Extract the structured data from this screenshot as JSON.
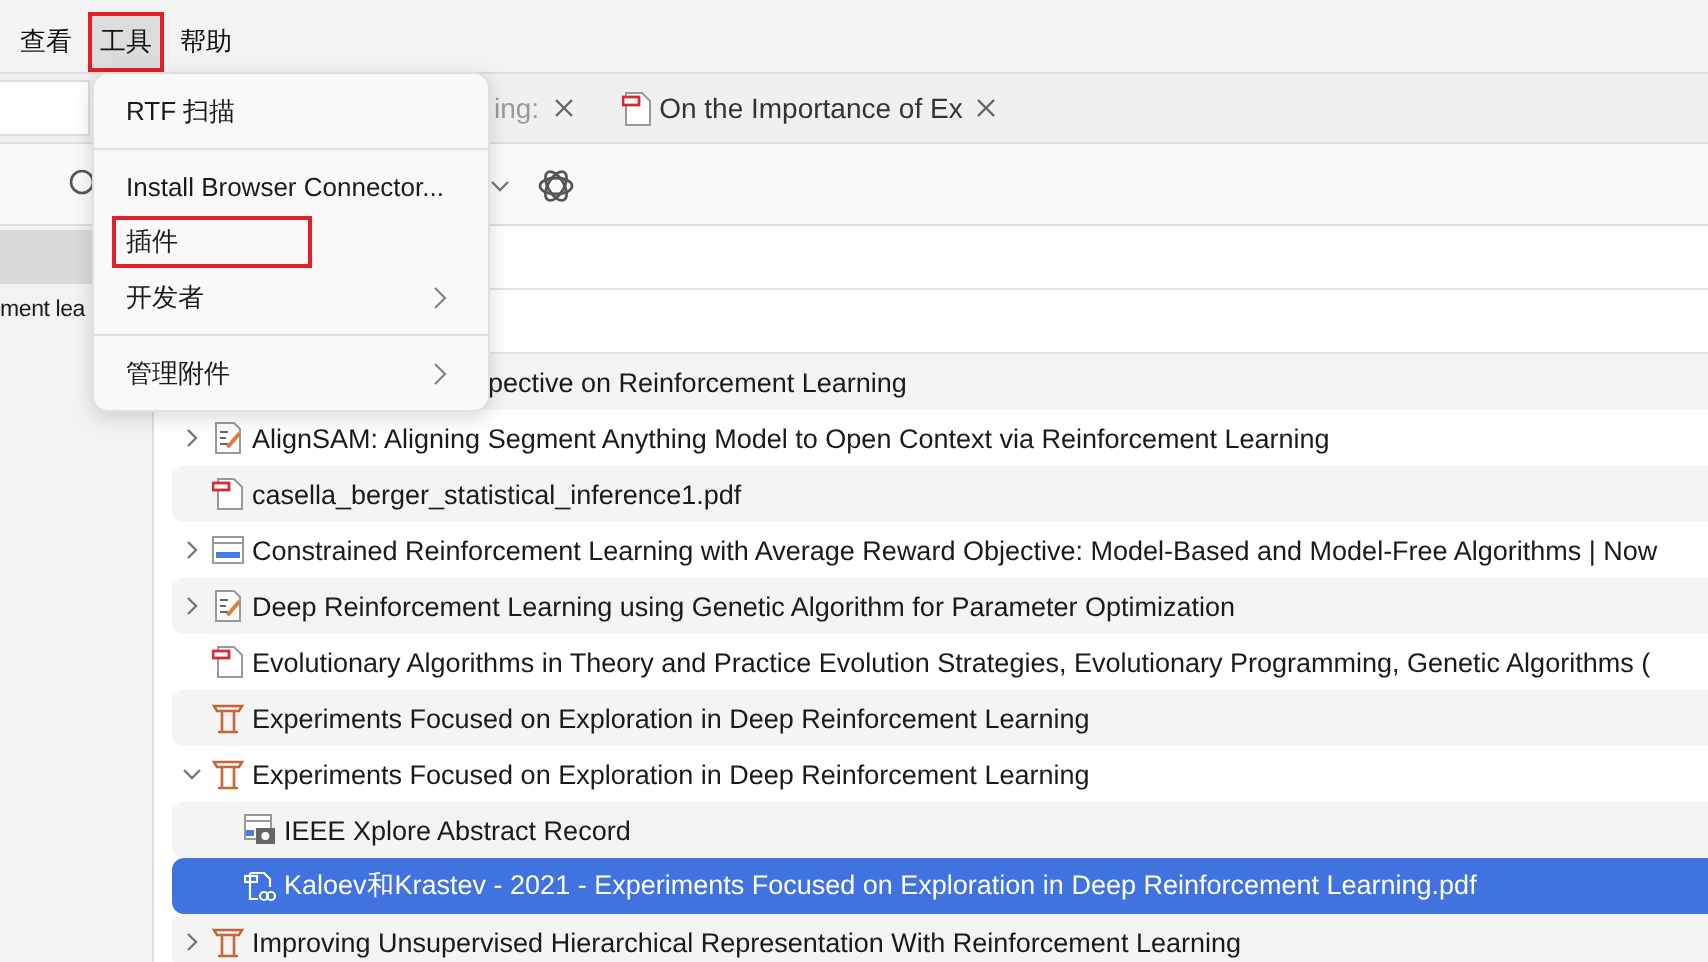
{
  "menu_bar": [
    {
      "label": "查看",
      "selected": false,
      "highlighted": false
    },
    {
      "label": "工具",
      "selected": true,
      "highlighted": true
    },
    {
      "label": "帮助",
      "selected": false,
      "highlighted": false
    }
  ],
  "tabs": [
    {
      "label": "ing:",
      "selected": false,
      "kind": "plain"
    },
    {
      "label": "On the Importance of Ex",
      "selected": false,
      "kind": "pdf"
    }
  ],
  "sidebar": {
    "items": [
      {
        "selected": true
      },
      {
        "label": "ment lea",
        "selected": false
      }
    ]
  },
  "tools_menu": {
    "items": [
      {
        "kind": "item",
        "label": "RTF 扫描",
        "highlighted": false
      },
      {
        "kind": "separator"
      },
      {
        "kind": "item",
        "label": "Install Browser Connector...",
        "highlighted": false
      },
      {
        "kind": "item",
        "label": "插件",
        "highlighted": true
      },
      {
        "kind": "submenu",
        "label": "开发者",
        "highlighted": false
      },
      {
        "kind": "separator"
      },
      {
        "kind": "submenu",
        "label": "管理附件",
        "highlighted": false
      }
    ]
  },
  "items": [
    {
      "kind": "covered",
      "title": "pective on Reinforcement Learning",
      "selected": false
    },
    {
      "kind": "notes",
      "title": "AlignSAM: Aligning Segment Anything Model to Open Context via Reinforcement Learning",
      "expanded": false,
      "selected": false
    },
    {
      "kind": "pdf",
      "title": "casella_berger_statistical_inference1.pdf",
      "selected": false
    },
    {
      "kind": "webpage",
      "title": "Constrained Reinforcement Learning with Average Reward Objective: Model-Based and Model-Free Algorithms | Now",
      "expanded": false,
      "selected": false
    },
    {
      "kind": "notes",
      "title": "Deep Reinforcement Learning using Genetic Algorithm for Parameter Optimization",
      "expanded": false,
      "selected": false
    },
    {
      "kind": "pdf",
      "title": "Evolutionary Algorithms in Theory and Practice Evolution Strategies, Evolutionary Programming, Genetic Algorithms (",
      "selected": false
    },
    {
      "kind": "presentation",
      "title": "Experiments Focused on Exploration in Deep Reinforcement Learning",
      "selected": false
    },
    {
      "kind": "presentation",
      "title": "Experiments Focused on Exploration in Deep Reinforcement Learning",
      "expanded": true,
      "selected": false,
      "children": [
        {
          "kind": "snapshot",
          "title": "IEEE Xplore Abstract Record",
          "selected": false
        },
        {
          "kind": "pdf-link",
          "title": "Kaloev和Krastev - 2021 - Experiments Focused on Exploration in Deep Reinforcement Learning.pdf",
          "selected": true
        }
      ]
    },
    {
      "kind": "presentation",
      "title": "Improving Unsupervised Hierarchical Representation With Reinforcement Learning",
      "expanded": false,
      "selected": false
    }
  ]
}
